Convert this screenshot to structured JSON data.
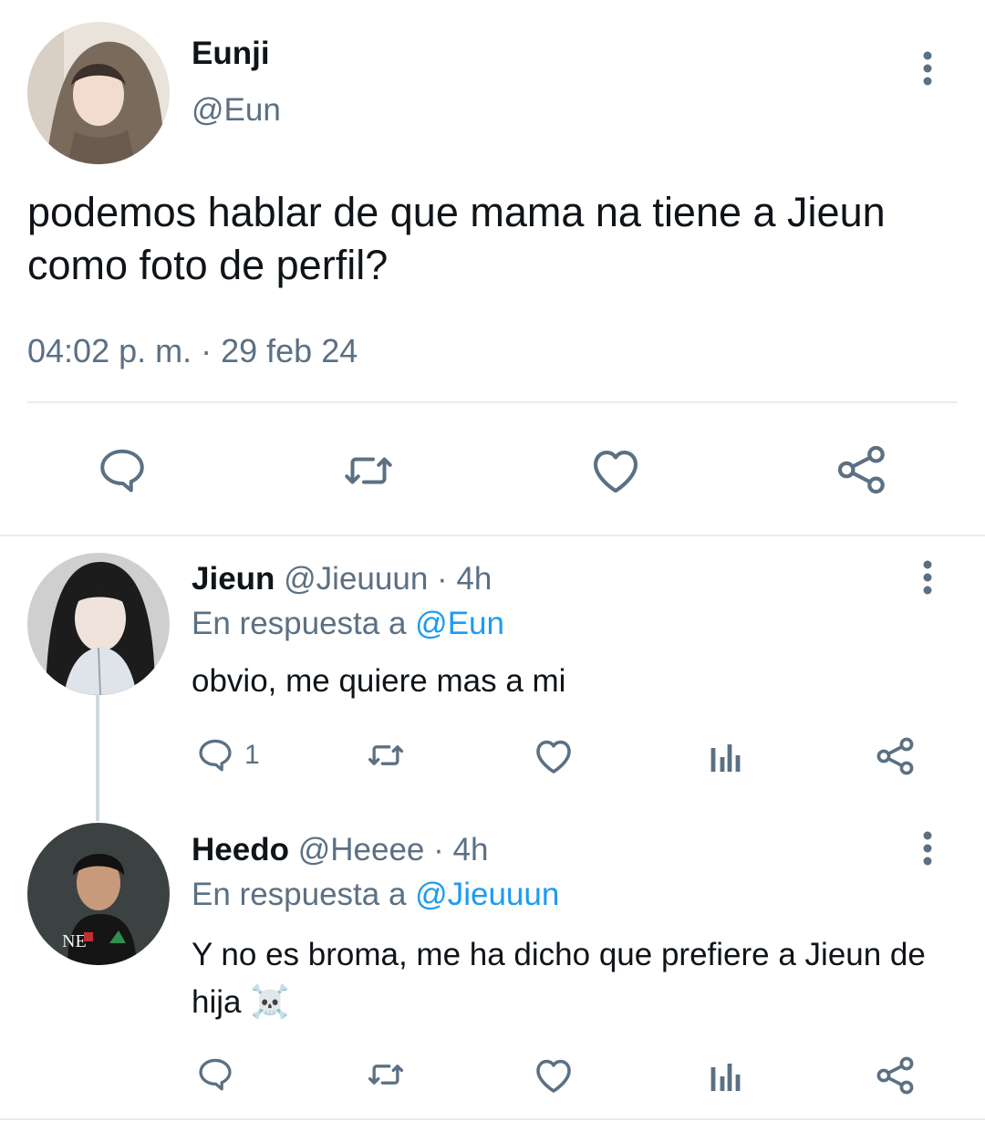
{
  "main_tweet": {
    "display_name": "Eunji",
    "handle": "@Eun",
    "text": "podemos hablar de que mama na tiene a Jieun como foto de perfil?",
    "timestamp": "04:02 p. m. · 29 feb 24",
    "actions": [
      "reply-icon",
      "retweet-icon",
      "like-icon",
      "share-icon"
    ]
  },
  "replies": [
    {
      "display_name": "Jieun",
      "handle": "@Jieuuun",
      "time": "· 4h",
      "replying_prefix": "En respuesta a",
      "replying_to": "@Eun",
      "text": "obvio, me quiere mas a mi",
      "reply_count": "1",
      "actions": [
        "reply-icon",
        "retweet-icon",
        "like-icon",
        "analytics-icon",
        "share-icon"
      ]
    },
    {
      "display_name": "Heedo",
      "handle": "@Heeee",
      "time": "· 4h",
      "replying_prefix": "En respuesta a",
      "replying_to": "@Jieuuun",
      "text": "Y no es broma, me ha dicho que prefiere a Jieun de hija ☠️",
      "reply_count": "",
      "actions": [
        "reply-icon",
        "retweet-icon",
        "like-icon",
        "analytics-icon",
        "share-icon"
      ]
    }
  ],
  "colors": {
    "text": "#0f1419",
    "muted": "#5b7083",
    "link": "#1d9bf0",
    "divider": "#e6ecf0"
  }
}
